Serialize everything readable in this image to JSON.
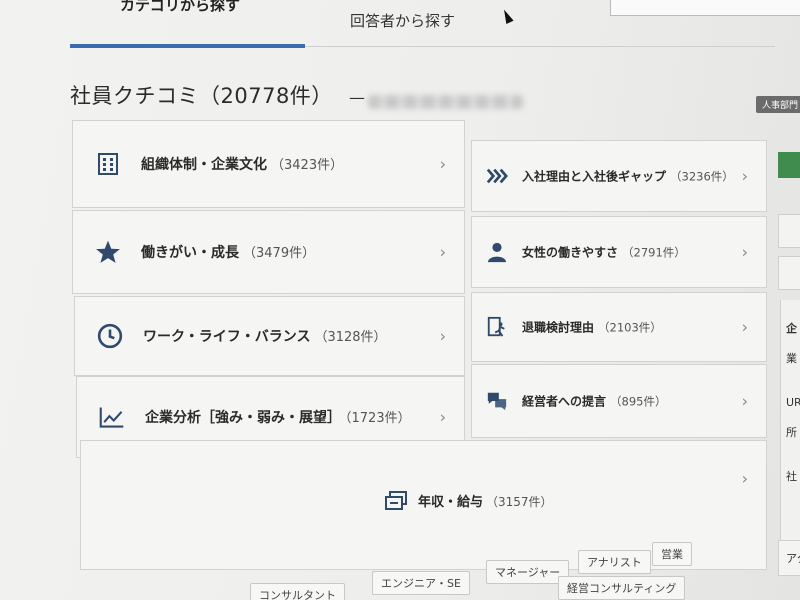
{
  "tabs": {
    "active_label": "カテゴリから探す",
    "inactive_label": "回答者から探す"
  },
  "heading": {
    "title": "社員クチコミ（20778件）",
    "dash": "—"
  },
  "hr_badge": "人事部門",
  "categories": [
    {
      "label": "組織体制・企業文化",
      "count": "（3423件）",
      "icon": "building-icon"
    },
    {
      "label": "入社理由と入社後ギャップ",
      "count": "（3236件）",
      "icon": "chevrons-right-icon"
    },
    {
      "label": "働きがい・成長",
      "count": "（3479件）",
      "icon": "star-icon"
    },
    {
      "label": "女性の働きやすさ",
      "count": "（2791件）",
      "icon": "person-icon"
    },
    {
      "label": "ワーク・ライフ・バランス",
      "count": "（3128件）",
      "icon": "clock-icon"
    },
    {
      "label": "退職検討理由",
      "count": "（2103件）",
      "icon": "exit-icon"
    },
    {
      "label": "企業分析［強み・弱み・展望］",
      "count": "（1723件）",
      "icon": "line-chart-icon"
    },
    {
      "label": "経営者への提言",
      "count": "（895件）",
      "icon": "speech-bubbles-icon"
    },
    {
      "label": "年収・給与",
      "count": "（3157件）",
      "icon": "money-icon"
    }
  ],
  "tags": [
    "コンサルタント",
    "エンジニア・SE",
    "マネージャー",
    "アナリスト",
    "営業",
    "経営コンサルティング"
  ],
  "sidebar": {
    "t1": "企",
    "t2": "業",
    "t3": "UR",
    "t4": "所",
    "t5": "社",
    "t6": "アク"
  },
  "colors": {
    "accent": "#3a6db0",
    "icon": "#2f4a6d",
    "side_green": "#3f8c4e"
  }
}
